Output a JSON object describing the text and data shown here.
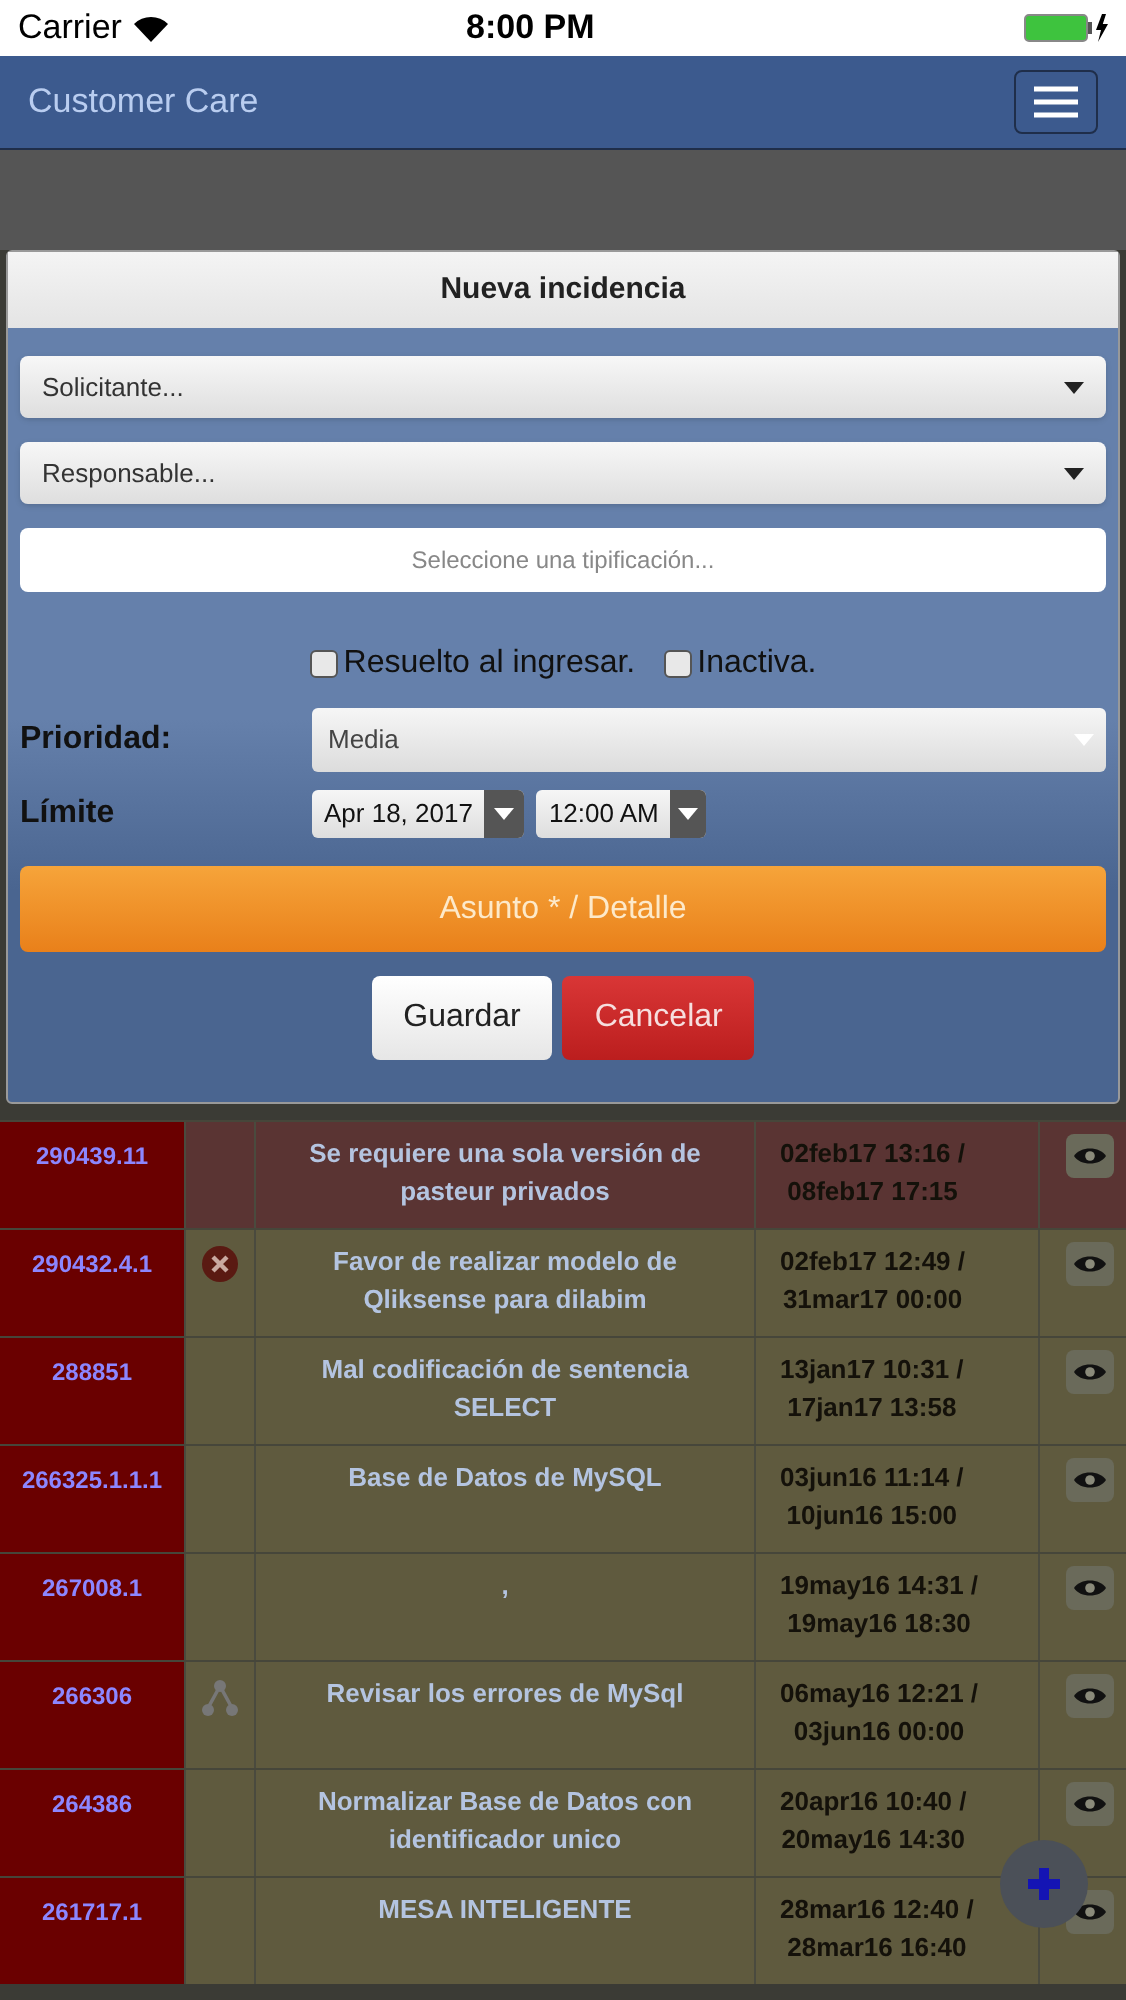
{
  "status_bar": {
    "carrier": "Carrier",
    "time": "8:00 PM"
  },
  "navbar": {
    "title": "Customer Care"
  },
  "modal": {
    "title": "Nueva incidencia",
    "selects": [
      {
        "placeholder": "Solicitante..."
      },
      {
        "placeholder": "Responsable..."
      }
    ],
    "tipificacion": {
      "placeholder": "Seleccione una tipificación..."
    },
    "checkboxes": [
      {
        "label": "Resuelto al ingresar.",
        "checked": false
      },
      {
        "label": "Inactiva.",
        "checked": false
      }
    ],
    "prioridad": {
      "label": "Prioridad:",
      "value": "Media"
    },
    "limite": {
      "label": "Límite",
      "date": "Apr 18, 2017",
      "time": "12:00 AM"
    },
    "detail_button": "Asunto * / Detalle",
    "buttons": [
      {
        "label": "Guardar",
        "kind": "default"
      },
      {
        "label": "Cancelar",
        "kind": "danger"
      }
    ]
  },
  "table": {
    "rows": [
      {
        "code": "290439.11",
        "kind": "plain",
        "subject": "Se requiere una sola versión de pasteur privados",
        "dates": "02feb17 13:16 / 08feb17 17:15",
        "color": "#5a3433"
      },
      {
        "code": "290432.4.1",
        "kind": "error",
        "subject": "Favor de realizar modelo de Qliksense para dilabim",
        "dates": "02feb17 12:49 / 31mar17 00:00",
        "color": "#5f5a3e"
      },
      {
        "code": "288851",
        "kind": "plain",
        "subject": "Mal codificación de sentencia SELECT",
        "dates": "13jan17 10:31 / 17jan17 13:58",
        "color": "#5f5a3e"
      },
      {
        "code": "266325.1.1.1",
        "kind": "plain",
        "subject": "Base de Datos de MySQL",
        "dates": "03jun16 11:14 / 10jun16 15:00",
        "color": "#5f5a3e"
      },
      {
        "code": "267008.1",
        "kind": "plain",
        "subject": ",",
        "dates": "19may16 14:31 / 19may16 18:30",
        "color": "#5f5a3e"
      },
      {
        "code": "266306",
        "kind": "linked",
        "subject": "Revisar los errores de MySql",
        "dates": "06may16 12:21 / 03jun16 00:00",
        "color": "#5f5a3e"
      },
      {
        "code": "264386",
        "kind": "plain",
        "subject": "Normalizar Base de Datos con identificador unico",
        "dates": "20apr16 10:40 / 20may16 14:30",
        "color": "#5f5a3e"
      },
      {
        "code": "261717.1",
        "kind": "plain",
        "subject": "MESA INTELIGENTE",
        "dates": "28mar16 12:40 / 28mar16 16:40",
        "color": "#5f5a3e"
      }
    ]
  }
}
